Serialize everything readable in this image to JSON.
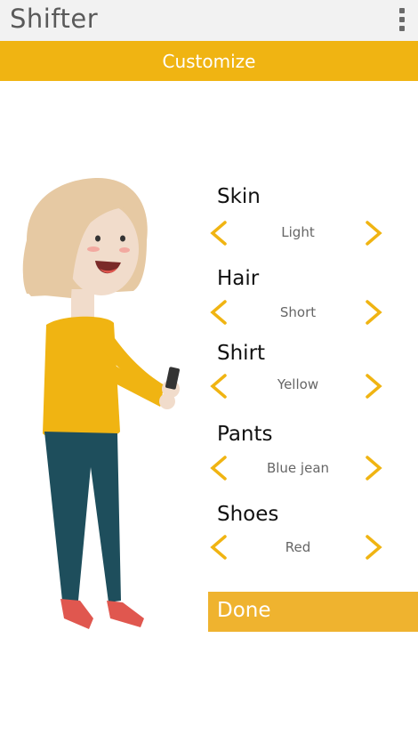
{
  "app": {
    "title": "Shifter",
    "menu_icon": "overflow-menu-icon"
  },
  "banner": {
    "title": "Customize"
  },
  "colors": {
    "accent": "#f0b412",
    "done_button": "#efb32f",
    "appbar": "#f2f2f2",
    "arrow": "#f0b412"
  },
  "options": [
    {
      "label": "Skin",
      "value": "Light"
    },
    {
      "label": "Hair",
      "value": "Short"
    },
    {
      "label": "Shirt",
      "value": "Yellow"
    },
    {
      "label": "Pants",
      "value": "Blue jean"
    },
    {
      "label": "Shoes",
      "value": "Red"
    }
  ],
  "done": {
    "label": "Done"
  }
}
